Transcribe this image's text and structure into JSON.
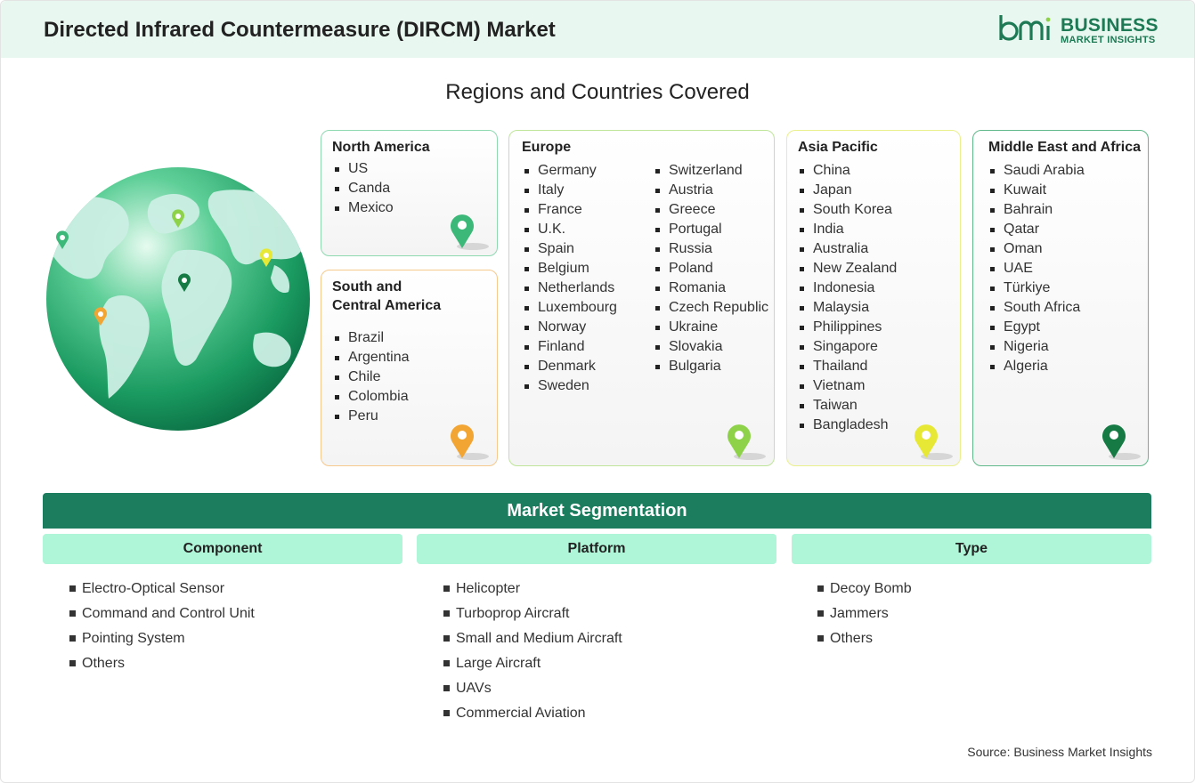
{
  "header": {
    "title": "Directed Infrared Countermeasure (DIRCM) Market",
    "logo_line1": "BUSINESS",
    "logo_line2": "MARKET INSIGHTS",
    "logo_mark": "bmi"
  },
  "regions": {
    "title": "Regions and Countries Covered",
    "north_america": {
      "name": "North America",
      "color": "#3cb878",
      "items": [
        "US",
        "Canda",
        "Mexico"
      ]
    },
    "south_central_america": {
      "name_line1": "South and",
      "name_line2": "Central America",
      "color": "#f2a533",
      "items": [
        "Brazil",
        "Argentina",
        "Chile",
        "Colombia",
        "Peru"
      ]
    },
    "europe": {
      "name": "Europe",
      "color": "#8ed24a",
      "col1": [
        "Germany",
        "Italy",
        "France",
        "U.K.",
        "Spain",
        "Belgium",
        "Netherlands",
        "Luxembourg",
        "Norway",
        "Finland",
        "Denmark",
        "Sweden"
      ],
      "col2": [
        "Switzerland",
        "Austria",
        "Greece",
        "Portugal",
        "Russia",
        "Poland",
        "Romania",
        "Czech Republic",
        "Ukraine",
        "Slovakia",
        "Bulgaria"
      ]
    },
    "asia_pacific": {
      "name": "Asia Pacific",
      "color": "#e6e835",
      "items": [
        "China",
        "Japan",
        "South Korea",
        "India",
        "Australia",
        "New Zealand",
        "Indonesia",
        "Malaysia",
        "Philippines",
        "Singapore",
        "Thailand",
        "Vietnam",
        "Taiwan",
        "Bangladesh"
      ]
    },
    "middle_east_africa": {
      "name": "Middle East and Africa",
      "color": "#157a44",
      "items": [
        "Saudi Arabia",
        "Kuwait",
        "Bahrain",
        "Qatar",
        "Oman",
        "UAE",
        "Türkiye",
        "South Africa",
        "Egypt",
        "Nigeria",
        "Algeria"
      ]
    }
  },
  "segmentation": {
    "title": "Market Segmentation",
    "component": {
      "heading": "Component",
      "items": [
        "Electro-Optical Sensor",
        "Command and Control Unit",
        "Pointing System",
        "Others"
      ]
    },
    "platform": {
      "heading": "Platform",
      "items": [
        "Helicopter",
        "Turboprop Aircraft",
        "Small and Medium Aircraft",
        "Large Aircraft",
        "UAVs",
        "Commercial Aviation"
      ]
    },
    "type": {
      "heading": "Type",
      "items": [
        "Decoy Bomb",
        "Jammers",
        "Others"
      ]
    }
  },
  "footer": {
    "source": "Source: Business Market Insights"
  }
}
